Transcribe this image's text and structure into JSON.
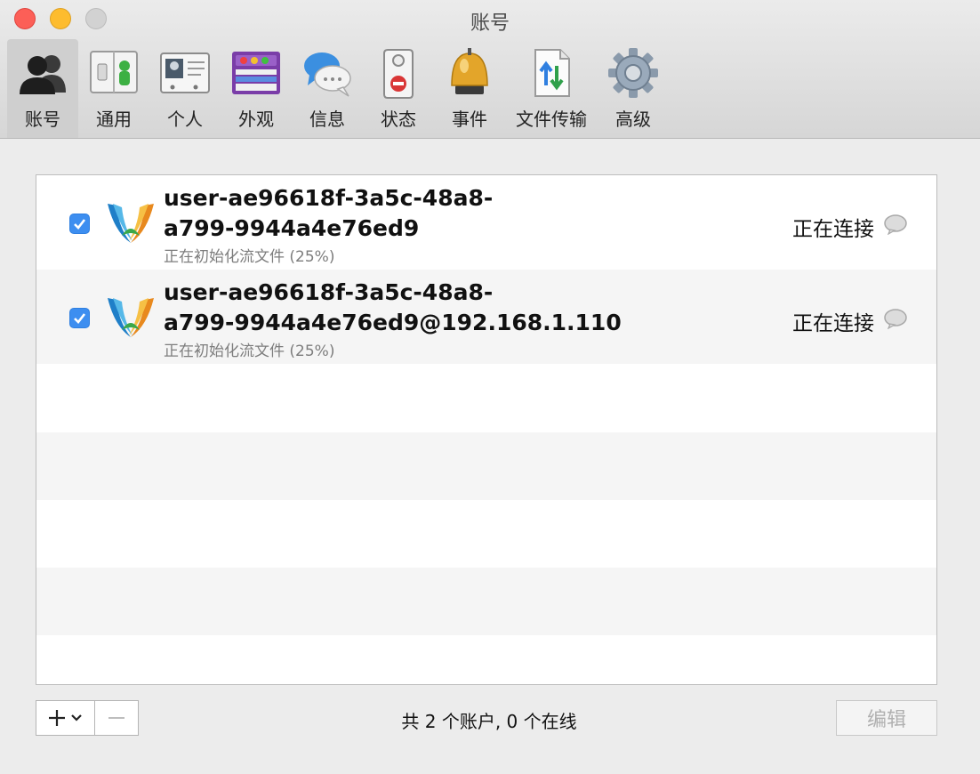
{
  "window": {
    "title": "账号"
  },
  "toolbar": {
    "items": [
      {
        "label": "账号",
        "icon": "users-icon",
        "selected": true
      },
      {
        "label": "通用",
        "icon": "switch-icon"
      },
      {
        "label": "个人",
        "icon": "id-card-icon"
      },
      {
        "label": "外观",
        "icon": "appearance-icon"
      },
      {
        "label": "信息",
        "icon": "chat-bubbles-icon"
      },
      {
        "label": "状态",
        "icon": "door-hanger-icon"
      },
      {
        "label": "事件",
        "icon": "bell-icon"
      },
      {
        "label": "文件传输",
        "icon": "file-transfer-icon"
      },
      {
        "label": "高级",
        "icon": "gear-icon"
      }
    ]
  },
  "accounts": [
    {
      "enabled": true,
      "name_line1": "user-ae96618f-3a5c-48a8-",
      "name_line2": "a799-9944a4e76ed9",
      "subtitle": "正在初始化流文件 (25%)",
      "status": "正在连接",
      "logo": "xmpp-logo-icon",
      "status_icon": "speech-bubble-icon"
    },
    {
      "enabled": true,
      "name_line1": "user-ae96618f-3a5c-48a8-",
      "name_line2": "a799-9944a4e76ed9@192.168.1.110",
      "subtitle": "正在初始化流文件 (25%)",
      "status": "正在连接",
      "logo": "xmpp-logo-icon",
      "status_icon": "speech-bubble-icon"
    }
  ],
  "footer": {
    "summary": "共 2 个账户, 0 个在线",
    "edit_label": "编辑"
  },
  "colors": {
    "checkbox": "#3d8ef0",
    "close": "#fc5f57",
    "minimize": "#fdbc2e",
    "zoom": "#d2d2d2"
  }
}
